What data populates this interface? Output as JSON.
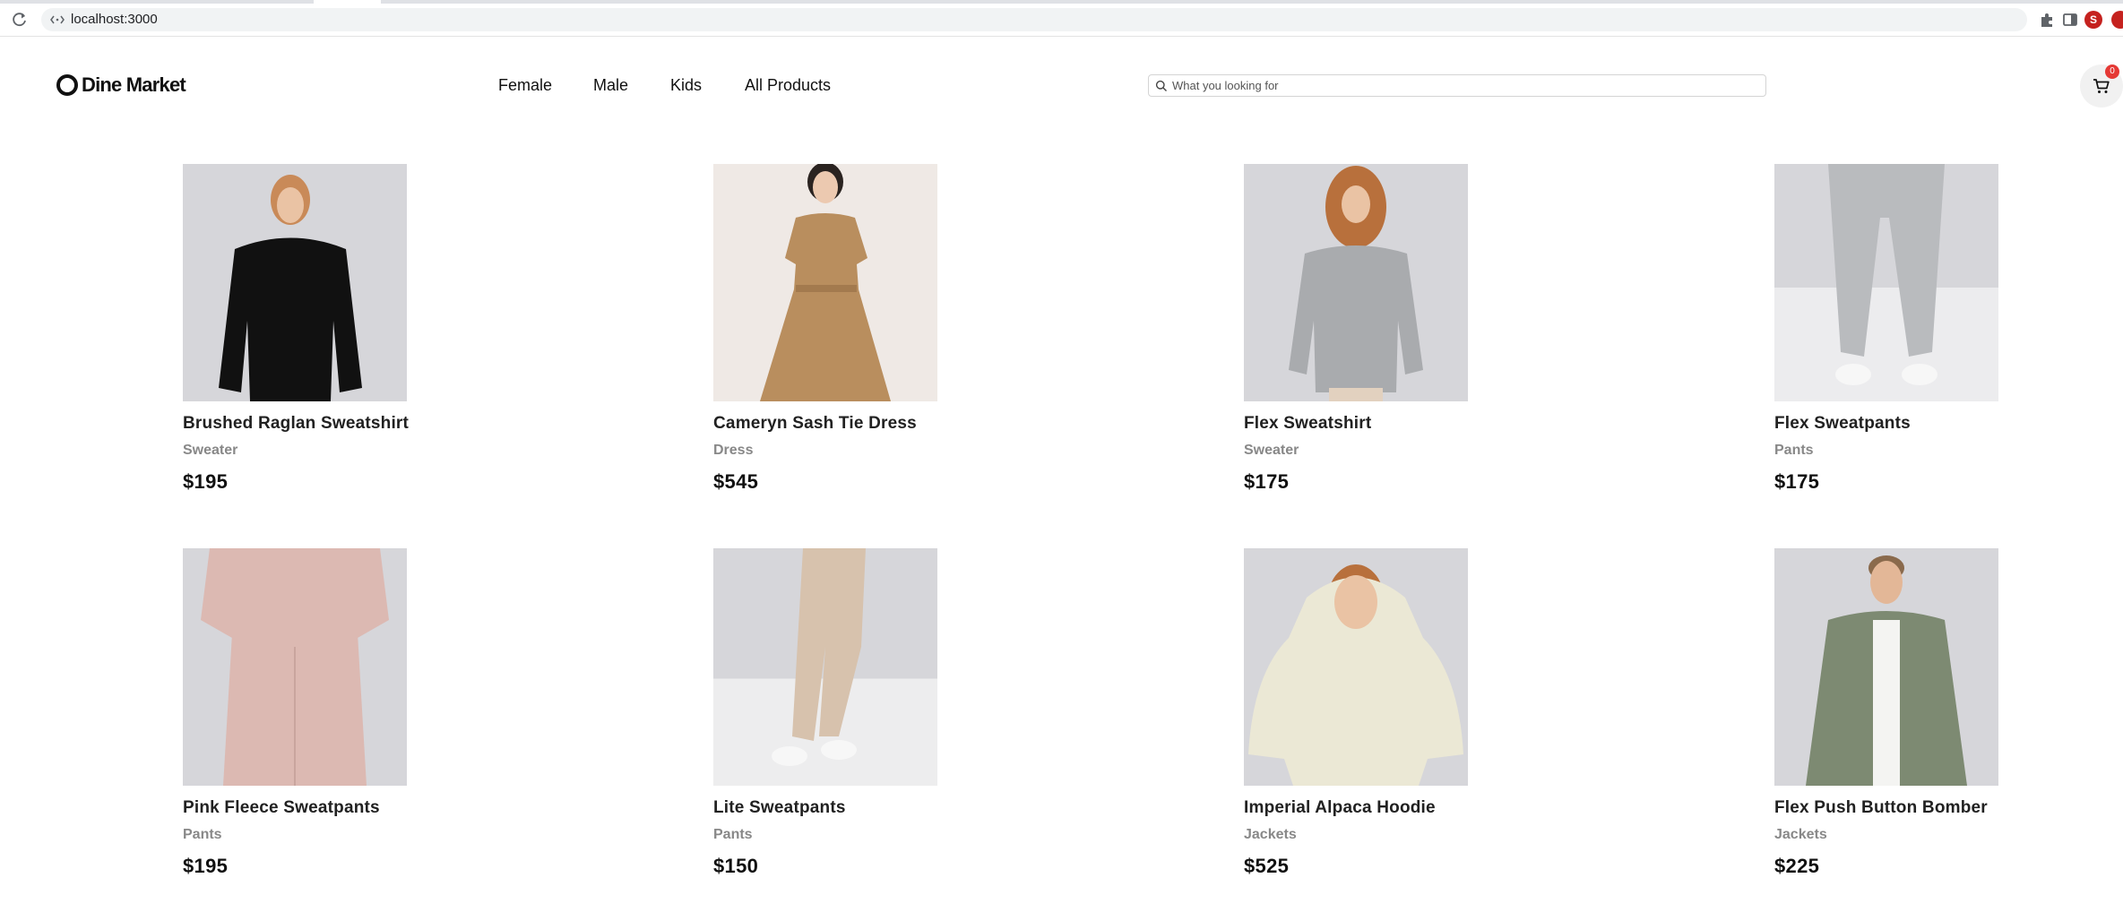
{
  "browser": {
    "url": "localhost:3000",
    "profile_initial": "S"
  },
  "header": {
    "logo_text": "Dine Market",
    "nav": [
      {
        "label": "Female"
      },
      {
        "label": "Male"
      },
      {
        "label": "Kids"
      },
      {
        "label": "All Products"
      }
    ],
    "search_placeholder": "What you looking for",
    "cart_count": "0"
  },
  "products": [
    {
      "name": "Brushed Raglan Sweatshirt",
      "category": "Sweater",
      "price": "$195",
      "garment_color": "#111111",
      "backdrop": "#d6d6da"
    },
    {
      "name": "Cameryn Sash Tie Dress",
      "category": "Dress",
      "price": "$545",
      "garment_color": "#b98e5e",
      "backdrop": "#efe9e5"
    },
    {
      "name": "Flex Sweatshirt",
      "category": "Sweater",
      "price": "$175",
      "garment_color": "#a9abae",
      "backdrop": "#d6d6da"
    },
    {
      "name": "Flex Sweatpants",
      "category": "Pants",
      "price": "$175",
      "garment_color": "#b9bbbe",
      "backdrop": "#d6d6da"
    },
    {
      "name": "Pink Fleece Sweatpants",
      "category": "Pants",
      "price": "$195",
      "garment_color": "#dcb9b2",
      "backdrop": "#d6d6da"
    },
    {
      "name": "Lite Sweatpants",
      "category": "Pants",
      "price": "$150",
      "garment_color": "#d7c2ad",
      "backdrop": "#d6d6da"
    },
    {
      "name": "Imperial Alpaca Hoodie",
      "category": "Jackets",
      "price": "$525",
      "garment_color": "#ebe8d5",
      "backdrop": "#d6d6da"
    },
    {
      "name": "Flex Push Button Bomber",
      "category": "Jackets",
      "price": "$225",
      "garment_color": "#7d8a72",
      "backdrop": "#d6d6da"
    }
  ]
}
